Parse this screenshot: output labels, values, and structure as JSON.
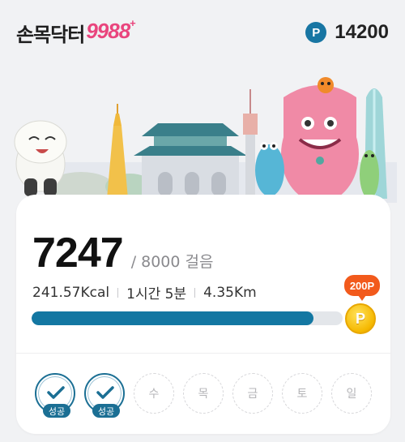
{
  "header": {
    "logo_text": "손목닥터",
    "logo_number": "9988",
    "logo_plus": "+",
    "points_icon": "P",
    "points_value": "14200"
  },
  "walk": {
    "steps": "7247",
    "goal_text": "/ 8000 걸음",
    "calories": "241.57Kcal",
    "duration": "1시간 5분",
    "distance": "4.35Km",
    "progress_fraction": 0.906,
    "reward_label": "200P",
    "coin_label": "P"
  },
  "week": {
    "days": [
      {
        "label": "",
        "status": "성공"
      },
      {
        "label": "",
        "status": "성공"
      },
      {
        "label": "수",
        "status": ""
      },
      {
        "label": "목",
        "status": ""
      },
      {
        "label": "금",
        "status": ""
      },
      {
        "label": "토",
        "status": ""
      },
      {
        "label": "일",
        "status": ""
      }
    ]
  },
  "colors": {
    "accent": "#1377a2",
    "brand_pink": "#e9457d",
    "reward_orange": "#f25a1c",
    "coin_gold": "#f5b800"
  }
}
